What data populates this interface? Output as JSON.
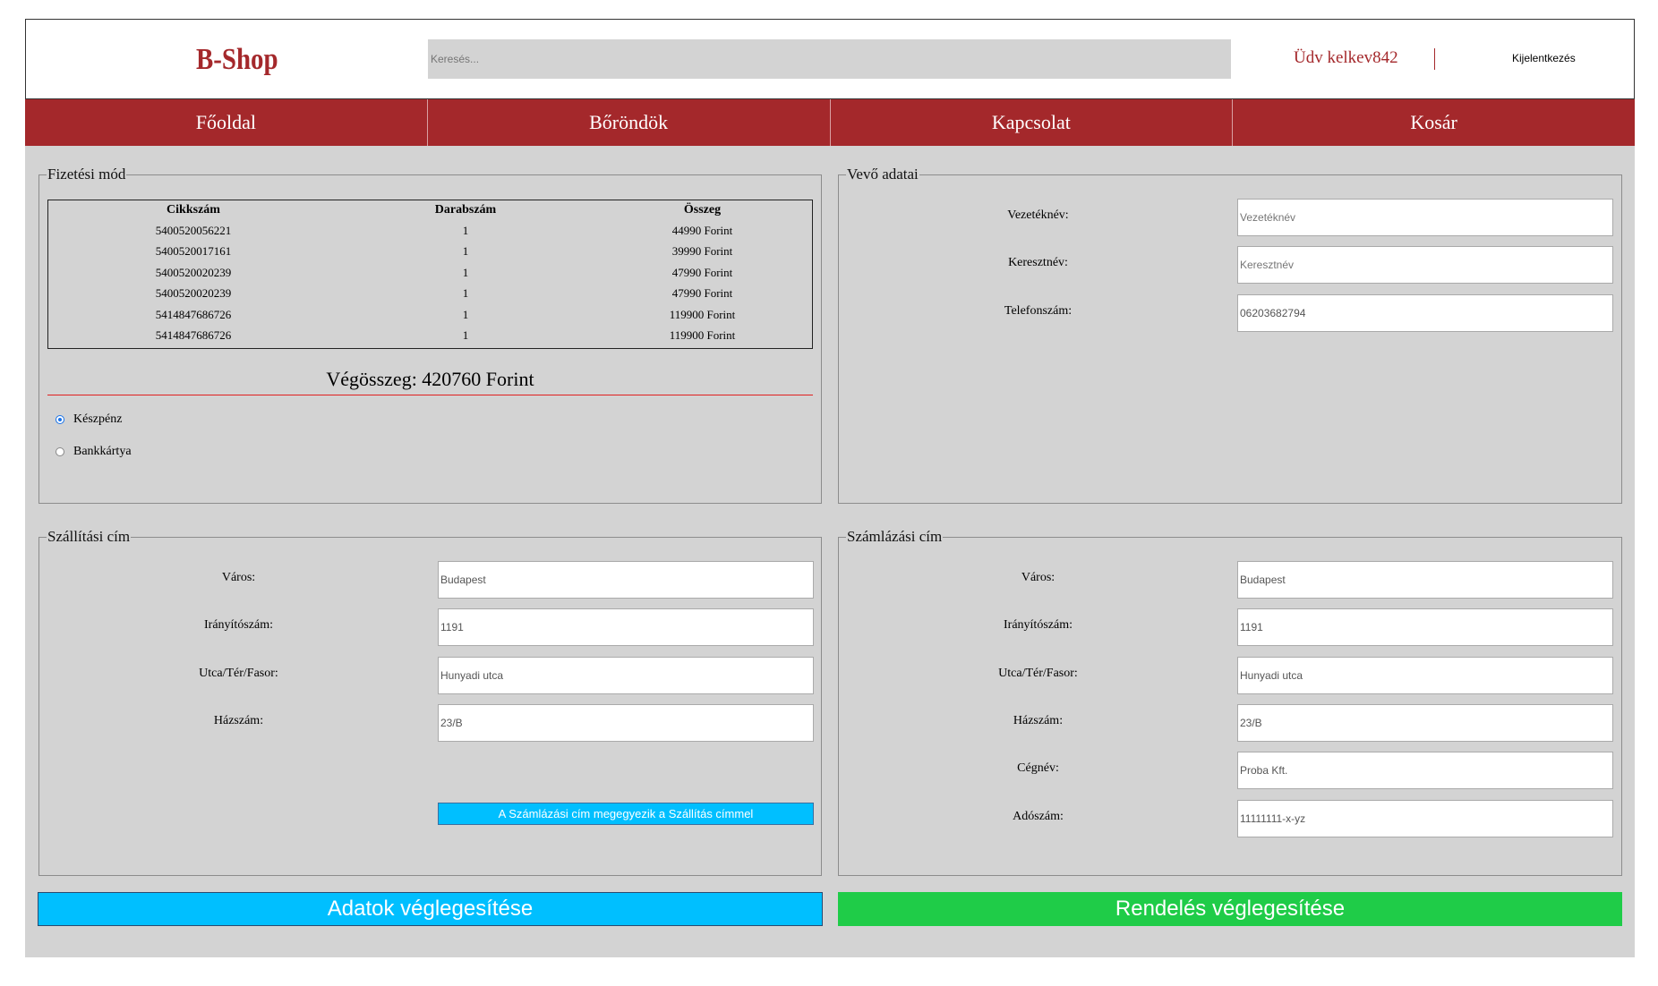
{
  "header": {
    "logo": "B-Shop",
    "search_placeholder": "Keresés...",
    "greeting": "Üdv kelkev842",
    "logout": "Kijelentkezés"
  },
  "nav": [
    "Főoldal",
    "Bőröndök",
    "Kapcsolat",
    "Kosár"
  ],
  "payment": {
    "legend": "Fizetési mód",
    "columns": [
      "Cikkszám",
      "Darabszám",
      "Összeg"
    ],
    "rows": [
      [
        "5400520056221",
        "1",
        "44990 Forint"
      ],
      [
        "5400520017161",
        "1",
        "39990 Forint"
      ],
      [
        "5400520020239",
        "1",
        "47990 Forint"
      ],
      [
        "5400520020239",
        "1",
        "47990 Forint"
      ],
      [
        "5414847686726",
        "1",
        "119900 Forint"
      ],
      [
        "5414847686726",
        "1",
        "119900 Forint"
      ]
    ],
    "total": "Végösszeg: 420760 Forint",
    "options": [
      {
        "label": "Készpénz",
        "selected": true
      },
      {
        "label": "Bankkártya",
        "selected": false
      }
    ]
  },
  "buyer": {
    "legend": "Vevő adatai",
    "fields": [
      {
        "label": "Vezetéknév:",
        "placeholder": "Vezetéknév",
        "value": ""
      },
      {
        "label": "Keresztnév:",
        "placeholder": "Keresztnév",
        "value": ""
      },
      {
        "label": "Telefonszám:",
        "placeholder": "",
        "value": "06203682794"
      }
    ]
  },
  "shipping": {
    "legend": "Szállítási cím",
    "fields": [
      {
        "label": "Város:",
        "value": "Budapest"
      },
      {
        "label": "Irányítószám:",
        "value": "1191"
      },
      {
        "label": "Utca/Tér/Fasor:",
        "value": "Hunyadi utca"
      },
      {
        "label": "Házszám:",
        "value": "23/B"
      }
    ],
    "copy_button": "A Számlázási cím megegyezik a Szállítás címmel"
  },
  "billing": {
    "legend": "Számlázási cím",
    "fields": [
      {
        "label": "Város:",
        "value": "Budapest"
      },
      {
        "label": "Irányítószám:",
        "value": "1191"
      },
      {
        "label": "Utca/Tér/Fasor:",
        "value": "Hunyadi utca"
      },
      {
        "label": "Házszám:",
        "value": "23/B"
      },
      {
        "label": "Cégnév:",
        "value": "Proba Kft."
      },
      {
        "label": "Adószám:",
        "value": "11111111-x-yz"
      }
    ]
  },
  "actions": {
    "finalize_data": "Adatok véglegesítése",
    "finalize_order": "Rendelés véglegesítése"
  },
  "colors": {
    "brand": "#a4282b",
    "blue_button": "#00bfff",
    "green_button": "#1fcc48",
    "panel_bg": "#d3d3d3"
  }
}
